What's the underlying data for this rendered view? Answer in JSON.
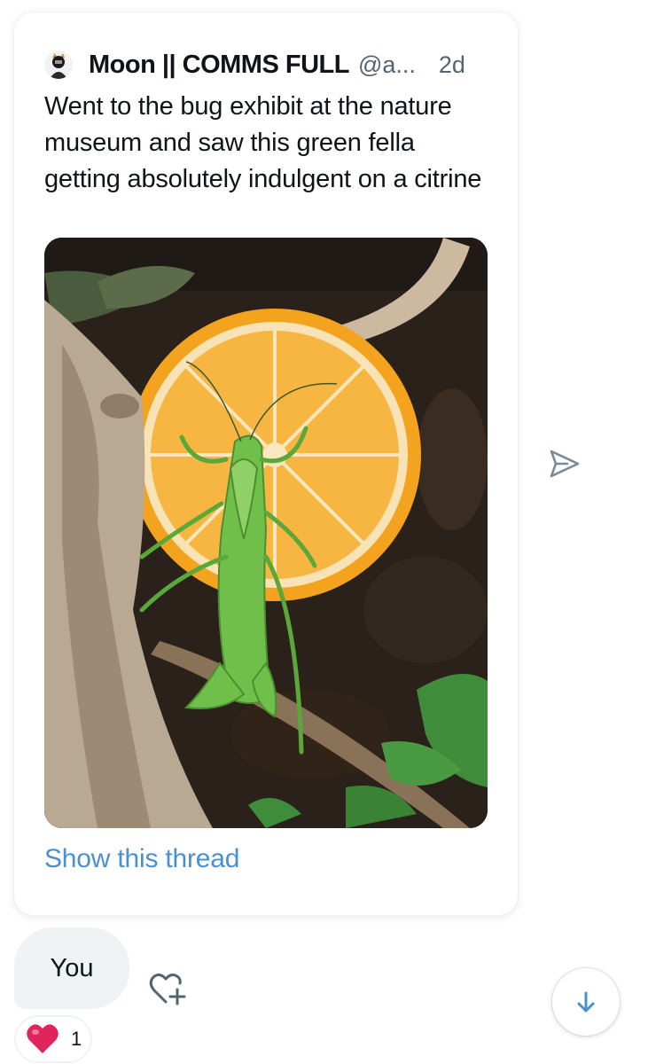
{
  "tweet": {
    "display_name": "Moon || COMMS FULL",
    "handle": "@a...",
    "time": "2d",
    "text": "Went to the bug exhibit at the nature museum and saw this green fella getting absolutely indulgent on a citrine",
    "show_thread_label": "Show this thread",
    "media": {
      "subject": "green katydid on an orange slice"
    }
  },
  "message": {
    "text": "You"
  },
  "reaction": {
    "emoji": "heart",
    "count": "1"
  },
  "icons": {
    "share": "send-icon",
    "add_reaction": "heart-plus-icon",
    "scroll": "arrow-down-icon"
  },
  "colors": {
    "link": "#4a90d0",
    "bubble": "#eff3f4",
    "heart": "#e0245e"
  }
}
